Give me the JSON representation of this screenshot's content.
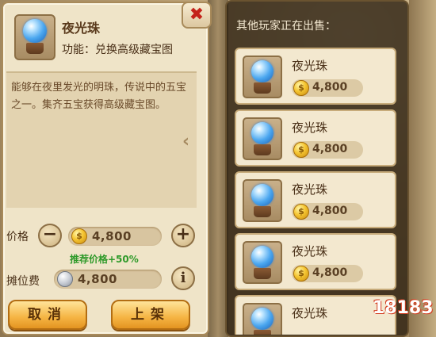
{
  "item": {
    "name": "夜光珠",
    "function": "功能：兑换高级藏宝图",
    "description": "能够在夜里发光的明珠，传说中的五宝之一。集齐五宝获得高级藏宝图。"
  },
  "price": {
    "label": "价格",
    "value": "4,800",
    "recommend": "推荐价格+50%",
    "minus_icon": "minus-icon",
    "plus_icon": "plus-icon"
  },
  "fee": {
    "label": "摊位费",
    "value": "4,800",
    "info_label": "i"
  },
  "buttons": {
    "cancel": "取消",
    "list": "上架",
    "close": "✖"
  },
  "market": {
    "title": "其他玩家正在出售：",
    "listings": [
      {
        "name": "夜光珠",
        "price": "4,800"
      },
      {
        "name": "夜光珠",
        "price": "4,800"
      },
      {
        "name": "夜光珠",
        "price": "4,800"
      },
      {
        "name": "夜光珠",
        "price": "4,800"
      },
      {
        "name": "夜光珠",
        "price": ""
      }
    ]
  },
  "watermark": "18183",
  "colors": {
    "pearl": "#4aa6ef",
    "coin": "#f5c531",
    "recommend_green": "#2f9a2a",
    "button_orange": "#f5b443",
    "close_red": "#c4221a"
  }
}
